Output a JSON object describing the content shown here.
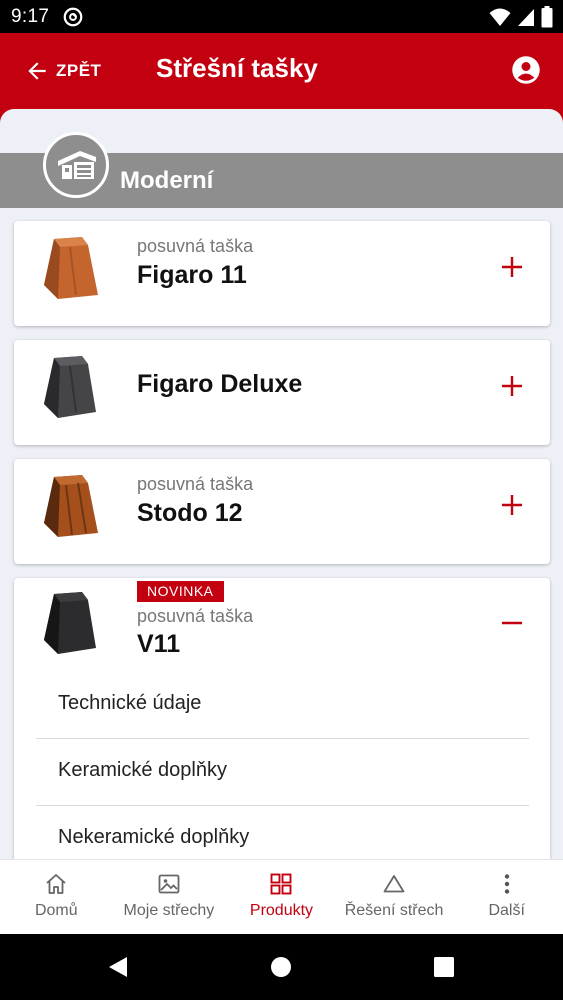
{
  "status": {
    "time": "9:17"
  },
  "app_bar": {
    "back_label": "ZPĚT",
    "title": "Střešní tašky"
  },
  "category": {
    "title": "Moderní"
  },
  "products": [
    {
      "subtitle": "posuvná taška",
      "name": "Figaro 11",
      "color": "#c5652e",
      "expanded": false
    },
    {
      "subtitle": "",
      "name": "Figaro Deluxe",
      "color": "#454548",
      "expanded": false
    },
    {
      "subtitle": "posuvná taška",
      "name": "Stodo 12",
      "color": "#a5501c",
      "expanded": false
    },
    {
      "subtitle": "posuvná taška",
      "name": "V11",
      "color": "#2c2c2e",
      "expanded": true,
      "badge": "NOVINKA",
      "sub_items": [
        "Technické údaje",
        "Keramické doplňky",
        "Nekeramické doplňky"
      ]
    }
  ],
  "bottom_nav": [
    {
      "label": "Domů",
      "icon": "home-icon"
    },
    {
      "label": "Moje střechy",
      "icon": "image-icon"
    },
    {
      "label": "Produkty",
      "icon": "grid-icon",
      "active": true
    },
    {
      "label": "Řešení střech",
      "icon": "triangle-icon"
    },
    {
      "label": "Další",
      "icon": "more-vert-icon"
    }
  ],
  "colors": {
    "brand": "#c3000f",
    "category_bar": "#8e8e8e",
    "background": "#eef0f7"
  }
}
